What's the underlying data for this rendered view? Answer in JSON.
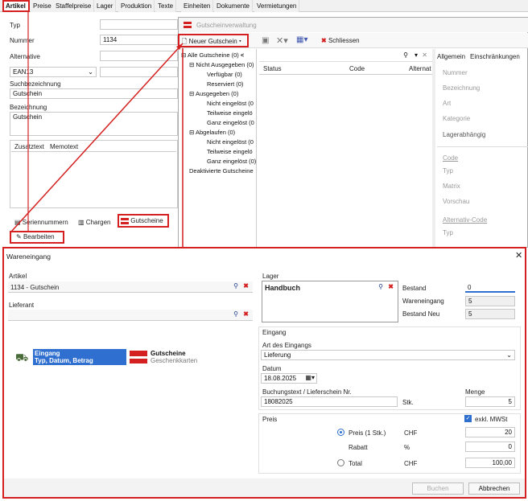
{
  "main_tabs": [
    "Artikel",
    "Preise",
    "Staffelpreise",
    "Lager",
    "Produktion",
    "Texte",
    "Einheiten",
    "Dokumente",
    "Vermietungen"
  ],
  "article": {
    "typ_label": "Typ",
    "nummer_label": "Nummer",
    "nummer_value": "1134",
    "alternative_label": "Alternative",
    "ean_value": "EAN13",
    "suchbezeichnung_label": "Suchbezeichnung",
    "suchbezeichnung_value": "Gutschein",
    "bezeichnung_label": "Bezeichnung",
    "bezeichnung_value": "Gutschein",
    "subtabs": [
      "Zusatztext",
      "Memotext"
    ],
    "bottom_tabs": [
      "Seriennummern",
      "Chargen",
      "Gutscheine"
    ],
    "bearbeiten": "Bearbeiten"
  },
  "gutschein": {
    "title": "Gutscheinverwaltung",
    "new_button": "Neuer Gutschein",
    "close_button": "Schliessen",
    "tree": [
      {
        "label": "Alle Gutscheine (0)",
        "level": 0
      },
      {
        "label": "Nicht Ausgegeben (0)",
        "level": 1
      },
      {
        "label": "Verfügbar (0)",
        "level": 2
      },
      {
        "label": "Reserviert (0)",
        "level": 2
      },
      {
        "label": "Ausgegeben (0)",
        "level": 1
      },
      {
        "label": "Nicht eingelöst (0",
        "level": 2
      },
      {
        "label": "Teilweise eingelö",
        "level": 2
      },
      {
        "label": "Ganz eingelöst (0",
        "level": 2
      },
      {
        "label": "Abgelaufen (0)",
        "level": 1
      },
      {
        "label": "Nicht eingelöst (0",
        "level": 2
      },
      {
        "label": "Teilweise eingelö",
        "level": 2
      },
      {
        "label": "Ganz eingelöst (0)",
        "level": 2
      },
      {
        "label": "Deaktivierte Gutscheine",
        "level": 0
      }
    ],
    "columns": [
      "Status",
      "Code",
      "Alternat"
    ],
    "right_tabs": [
      "Allgemein",
      "Einschränkungen"
    ],
    "right_labels_1": [
      "Nummer",
      "Bezeichnung",
      "Art",
      "Kategorie"
    ],
    "lagerabhaengig": "Lagerabhängig",
    "code_link": "Code",
    "right_labels_2": [
      "Typ",
      "Matrix",
      "Vorschau"
    ],
    "alt_code_link": "Alternativ-Code",
    "right_labels_3": [
      "Typ"
    ]
  },
  "wareneingang": {
    "title": "Wareneingang",
    "artikel_label": "Artikel",
    "artikel_value": "1134 - Gutschein",
    "lieferant_label": "Lieferant",
    "lieferant_value": "",
    "eingang_title": "Eingang",
    "eingang_sub": "Typ, Datum, Betrag",
    "gutscheine_title": "Gutscheine",
    "gutscheine_sub": "Geschenkkarten",
    "lager_label": "Lager",
    "lager_value": "Handbuch",
    "bestand_label": "Bestand",
    "bestand_value": "0",
    "wareneingang_label": "Wareneingang",
    "wareneingang_value": "5",
    "bestand_neu_label": "Bestand Neu",
    "bestand_neu_value": "5",
    "eingang_group": "Eingang",
    "art_label": "Art des Eingangs",
    "art_value": "Lieferung",
    "datum_label": "Datum",
    "datum_value": "18.08.2025",
    "buchung_label": "Buchungstext / Lieferschein Nr.",
    "buchung_value": "18082025",
    "stk_label": "Stk.",
    "menge_label": "Menge",
    "menge_value": "5",
    "preis_group": "Preis",
    "exkl_label": "exkl. MWSt",
    "preis_label": "Preis (1 Stk.)",
    "preis_currency": "CHF",
    "preis_value": "20",
    "rabatt_label": "Rabatt",
    "rabatt_unit": "%",
    "rabatt_value": "0",
    "total_label": "Total",
    "total_currency": "CHF",
    "total_value": "100,00",
    "buchen": "Buchen",
    "abbrechen": "Abbrechen"
  }
}
